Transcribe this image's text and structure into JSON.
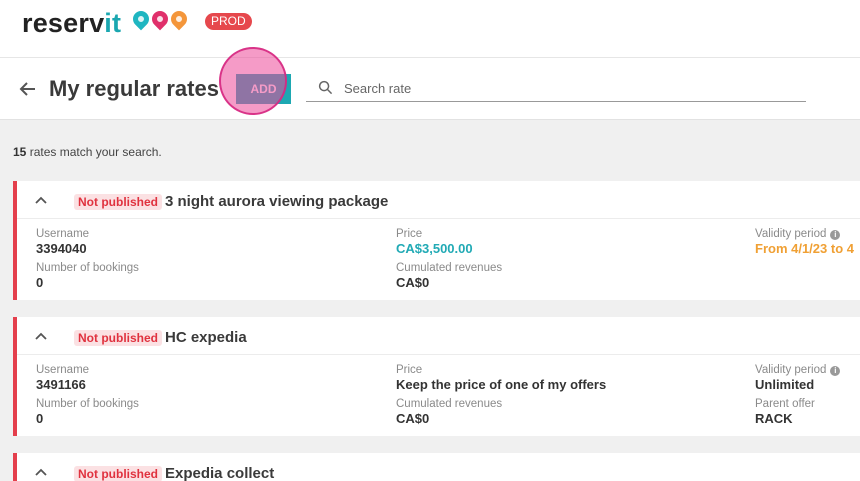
{
  "app": {
    "logo_main": "reserv",
    "logo_accent": "it",
    "environment": "PROD"
  },
  "header": {
    "title": "My regular rates",
    "add_label": "ADD",
    "search_placeholder": "Search rate"
  },
  "results": {
    "count": "15",
    "suffix": " rates match your search."
  },
  "labels": {
    "username": "Username",
    "bookings": "Number of bookings",
    "price": "Price",
    "revenues": "Cumulated revenues",
    "validity": "Validity period",
    "parent_offer": "Parent offer"
  },
  "rates": [
    {
      "status": "Not published",
      "name": "3 night aurora viewing package",
      "username": "3394040",
      "bookings": "0",
      "price": "CA$3,500.00",
      "revenues": "CA$0",
      "validity": "From 4/1/23 to 4"
    },
    {
      "status": "Not published",
      "name": "HC expedia",
      "username": "3491166",
      "bookings": "0",
      "price": "Keep the price of one of my offers",
      "revenues": "CA$0",
      "validity": "Unlimited",
      "parent_offer": "RACK"
    },
    {
      "status": "Not published",
      "name": "Expedia collect"
    }
  ],
  "colors": {
    "accent": "#1da8b2",
    "status_red": "#e43f4c",
    "validity_orange": "#f0a034",
    "highlight": "#ec4899"
  },
  "icons": {
    "back": "arrow-left-icon",
    "search": "search-icon",
    "collapse": "chevron-up-icon",
    "info": "info-icon"
  }
}
